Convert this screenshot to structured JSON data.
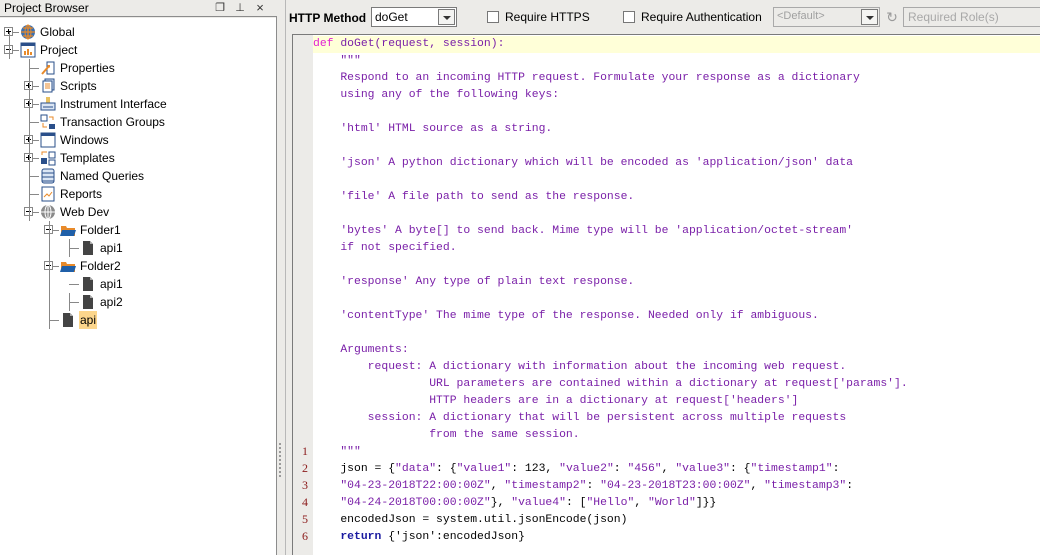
{
  "panel": {
    "title": "Project Browser",
    "restore_icon": "restore-icon",
    "pin_icon": "pin-icon",
    "close_icon": "close-icon",
    "restore_glyph": "❐",
    "pin_glyph": "⊥",
    "close_glyph": "×"
  },
  "tree": {
    "items": [
      {
        "label": "Global",
        "icon": "globe-icon",
        "expander": "plus",
        "selected": false
      },
      {
        "label": "Project",
        "icon": "project-icon",
        "expander": "minus",
        "selected": false
      },
      {
        "label": "Properties",
        "icon": "properties-icon",
        "expander": "none",
        "selected": false
      },
      {
        "label": "Scripts",
        "icon": "scripts-icon",
        "expander": "plus",
        "selected": false
      },
      {
        "label": "Instrument Interface",
        "icon": "instrument-icon",
        "expander": "plus",
        "selected": false
      },
      {
        "label": "Transaction Groups",
        "icon": "transaction-groups-icon",
        "expander": "none",
        "selected": false
      },
      {
        "label": "Windows",
        "icon": "windows-icon",
        "expander": "plus",
        "selected": false
      },
      {
        "label": "Templates",
        "icon": "templates-icon",
        "expander": "plus",
        "selected": false
      },
      {
        "label": "Named Queries",
        "icon": "database-icon",
        "expander": "none",
        "selected": false
      },
      {
        "label": "Reports",
        "icon": "reports-icon",
        "expander": "none",
        "selected": false
      },
      {
        "label": "Web Dev",
        "icon": "webdev-globe-icon",
        "expander": "minus",
        "selected": false
      },
      {
        "label": "Folder1",
        "icon": "folder-open-icon",
        "expander": "minus",
        "selected": false
      },
      {
        "label": "api1",
        "icon": "file-icon",
        "expander": "none",
        "selected": false
      },
      {
        "label": "Folder2",
        "icon": "folder-open-icon",
        "expander": "minus",
        "selected": false
      },
      {
        "label": "api1",
        "icon": "file-icon",
        "expander": "none",
        "selected": false
      },
      {
        "label": "api2",
        "icon": "file-icon",
        "expander": "none",
        "selected": false
      },
      {
        "label": "api",
        "icon": "file-icon",
        "expander": "none",
        "selected": true
      }
    ]
  },
  "toolbar": {
    "http_method_label": "HTTP Method",
    "http_method_value": "doGet",
    "require_https_label": "Require HTTPS",
    "require_https_checked": false,
    "require_auth_label": "Require Authentication",
    "require_auth_checked": false,
    "auth_profile_value": "<Default>",
    "required_roles_placeholder": "Required Role(s)",
    "refresh_glyph": "↻"
  },
  "editor": {
    "header_line": {
      "keyword": "def",
      "rest": " doGet(request, session):"
    },
    "docstring": [
      "    \"\"\"",
      "    Respond to an incoming HTTP request. Formulate your response as a dictionary",
      "    using any of the following keys:",
      "",
      "    'html' HTML source as a string.",
      "",
      "    'json' A python dictionary which will be encoded as 'application/json' data",
      "",
      "    'file' A file path to send as the response.",
      "",
      "    'bytes' A byte[] to send back. Mime type will be 'application/octet-stream'",
      "    if not specified.",
      "",
      "    'response' Any type of plain text response.",
      "",
      "    'contentType' The mime type of the response. Needed only if ambiguous.",
      "",
      "    Arguments:",
      "        request: A dictionary with information about the incoming web request.",
      "                 URL parameters are contained within a dictionary at request['params'].",
      "                 HTTP headers are in a dictionary at request['headers']",
      "        session: A dictionary that will be persistent across multiple requests",
      "                 from the same session."
    ],
    "lines": [
      {
        "num": "1",
        "text": "    \"\"\"",
        "kind": "doc"
      },
      {
        "num": "2",
        "text": "    json = {\"data\": {\"value1\": 123, \"value2\": \"456\", \"value3\": {\"timestamp1\":",
        "kind": "code"
      },
      {
        "num": "3",
        "text": "    \"04-23-2018T22:00:00Z\", \"timestamp2\": \"04-23-2018T23:00:00Z\", \"timestamp3\":",
        "kind": "code"
      },
      {
        "num": "4",
        "text": "    \"04-24-2018T00:00:00Z\"}, \"value4\": [\"Hello\", \"World\"]}}",
        "kind": "code"
      },
      {
        "num": "5",
        "text": "    encodedJson = system.util.jsonEncode(json)",
        "kind": "code"
      },
      {
        "num": "6",
        "text": "return {'json':encodedJson}",
        "kind": "return",
        "keyword": "return"
      }
    ]
  },
  "colors": {
    "keyword": "#e01fd4",
    "docstring": "#7a1fa8",
    "line_number": "#8b1a1a",
    "current_line": "#ffffd8",
    "selection": "#fcd68c"
  }
}
